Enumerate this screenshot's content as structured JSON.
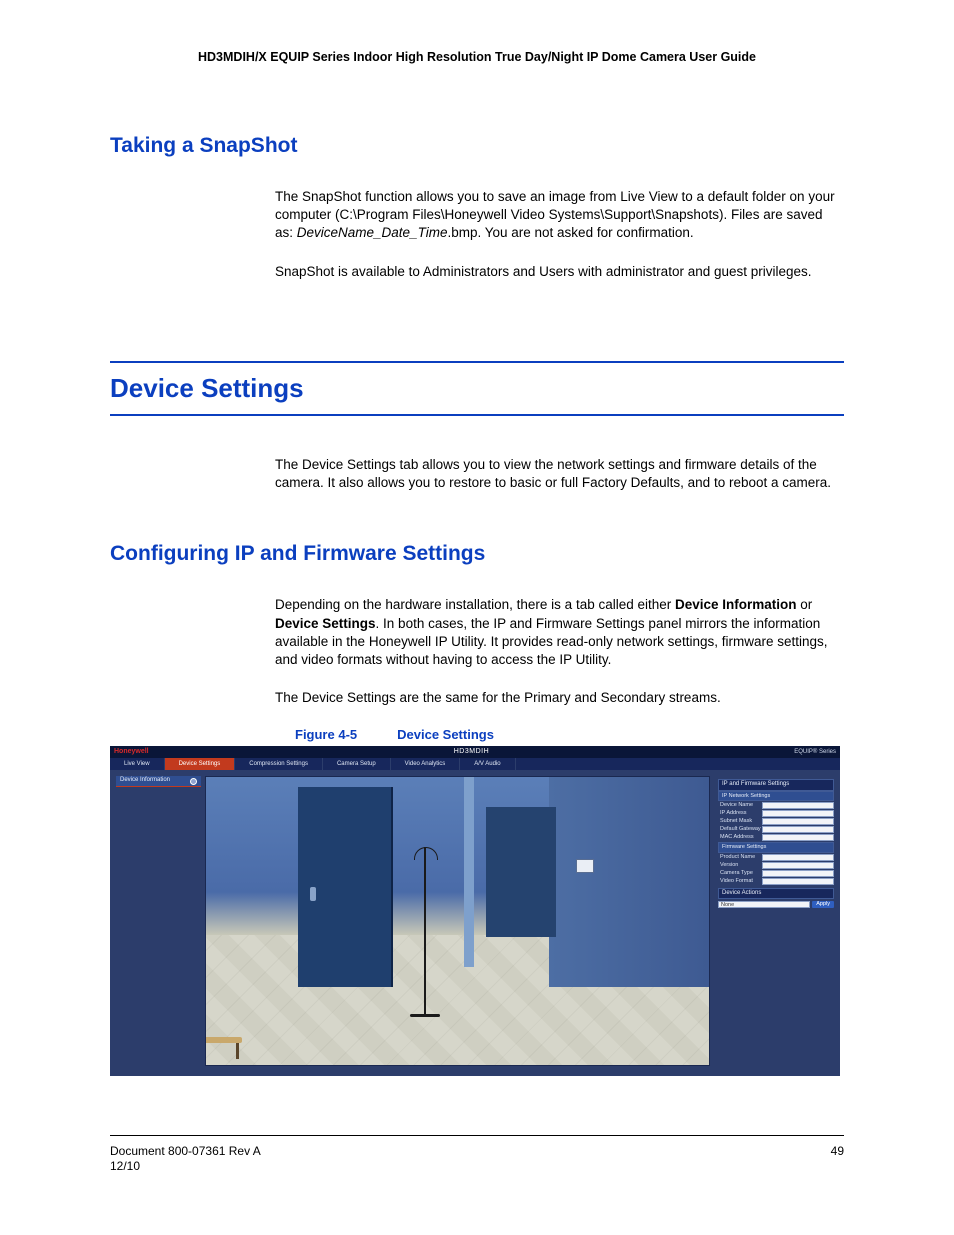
{
  "header": {
    "title": "HD3MDIH/X EQUIP Series Indoor High Resolution True Day/Night IP Dome Camera User Guide"
  },
  "section1": {
    "heading": "Taking a SnapShot",
    "p1a": "The SnapShot function allows you to save an image from Live View to a default folder on your computer (C:\\Program Files\\Honeywell Video Systems\\Support\\Snapshots). Files are saved as: ",
    "p1b_i": "DeviceName_Date_Time",
    "p1c": ".bmp. You are not asked for confirmation.",
    "p2": "SnapShot is available to Administrators and Users with administrator and guest privileges."
  },
  "section2": {
    "heading": "Device Settings",
    "p1": "The Device Settings tab allows you to view the network settings and firmware details of the camera. It also allows you to restore to basic or full Factory Defaults, and to reboot a camera."
  },
  "section3": {
    "heading": "Configuring IP and Firmware Settings",
    "p1a": "Depending on the hardware installation, there is a tab called either ",
    "p1b_b": "Device Information",
    "p1c": " or ",
    "p1d_b": "Device Settings",
    "p1e": ". In both cases, the IP and Firmware Settings panel mirrors the information available in the Honeywell IP Utility. It provides read-only network settings, firmware settings, and video formats without having to access the IP Utility.",
    "p2": "The Device Settings are the same for the Primary and Secondary streams."
  },
  "figure": {
    "label": "Figure 4-5",
    "caption": "Device Settings"
  },
  "screenshot": {
    "brand": "Honeywell",
    "model": "HD3MDIH",
    "equip": "EQUIP® Series",
    "nav": {
      "t1": "Live View",
      "t2": "Device Settings",
      "t3": "Compression Settings",
      "t4": "Camera Setup",
      "t5": "Video Analytics",
      "t6": "A/V Audio"
    },
    "leftbtn": "Device Information",
    "panel": {
      "sec1": "IP and Firmware Settings",
      "sub1": "IP Network Settings",
      "f1l": "Device Name",
      "f1v": "",
      "f2l": "IP Address",
      "f2v": "",
      "f3l": "Subnet Mask",
      "f3v": "",
      "f4l": "Default Gateway",
      "f4v": "",
      "f5l": "MAC Address",
      "f5v": "",
      "sub2": "Firmware Settings",
      "f6l": "Product Name",
      "f6v": "",
      "f7l": "Version",
      "f7v": "",
      "f8l": "Camera Type",
      "f8v": "",
      "f9l": "Video Format",
      "f9v": "",
      "sec2": "Device Actions",
      "sel": "None",
      "go": "Apply"
    }
  },
  "footer": {
    "doc": "Document 800-07361 Rev A",
    "date": "12/10",
    "page": "49"
  }
}
